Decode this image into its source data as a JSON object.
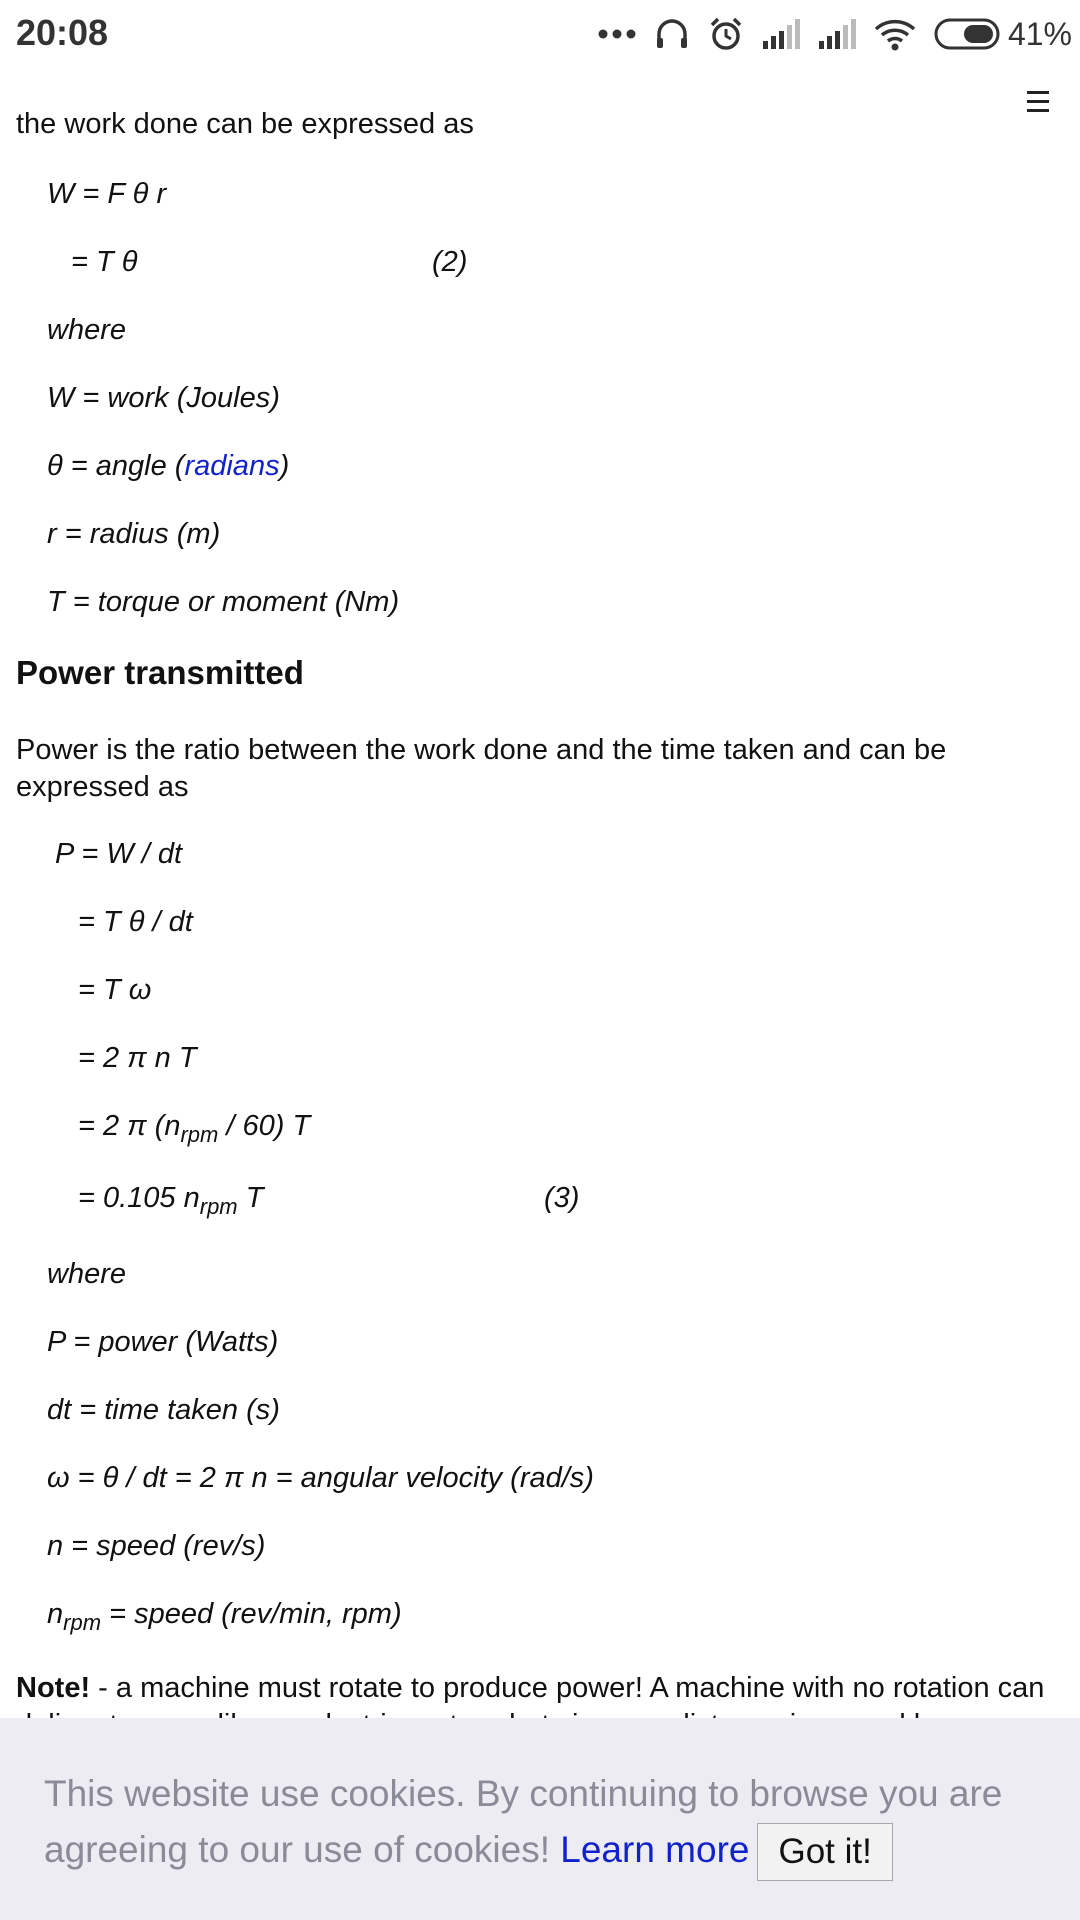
{
  "status_bar": {
    "time": "20:08",
    "battery": "41%",
    "icons": [
      "more-dots-icon",
      "headphones-icon",
      "alarm-icon",
      "signal-icon",
      "signal-icon",
      "wifi-icon",
      "battery-icon"
    ]
  },
  "menu": {
    "icon": "hamburger-icon"
  },
  "article": {
    "intro": "the work done can be expressed as",
    "work_eq": {
      "line1": "W = F θ r",
      "line2": "= T θ",
      "num": "(2)",
      "where": "where",
      "defs": [
        "W = work (Joules)",
        "r = radius (m)",
        "T = torque or moment (Nm)"
      ],
      "theta_prefix": "θ = angle (",
      "theta_link": "radians",
      "theta_suffix": ")"
    },
    "power_heading": "Power transmitted",
    "power_intro": "Power is the ratio between the work done and the time taken and can be expressed as",
    "power_eq": {
      "line1": "P = W / dt",
      "line2": "= T θ / dt",
      "line3": "= T ω",
      "line4": "= 2 π n T",
      "line5_a": "= 2 π (n",
      "line5_sub": "rpm",
      "line5_b": " / 60) T",
      "line6_a": "= 0.105 n",
      "line6_sub": "rpm",
      "line6_b": " T",
      "num": "(3)",
      "where": "where",
      "defs": [
        "P = power (Watts)",
        "dt = time taken (s)",
        "ω =  θ / dt = 2 π n = angular velocity (rad/s)",
        "n = speed (rev/s)"
      ],
      "nrpm_a": "n",
      "nrpm_sub": "rpm",
      "nrpm_b": " = speed (rev/min, rpm)"
    },
    "note_bold": "Note!",
    "note_text": " - a machine must rotate to produce power! A machine with no rotation can deliver torque - like an electric motor - but since no distance is moved by"
  },
  "cookie": {
    "text": "This website use cookies. By continuing to browse you are agreeing to our use of cookies! ",
    "learn_more": "Learn more",
    "button": "Got it!"
  },
  "colors": {
    "link": "#1122cc",
    "cookie_bg": "#ececf2",
    "cookie_text": "#8b8b98"
  }
}
